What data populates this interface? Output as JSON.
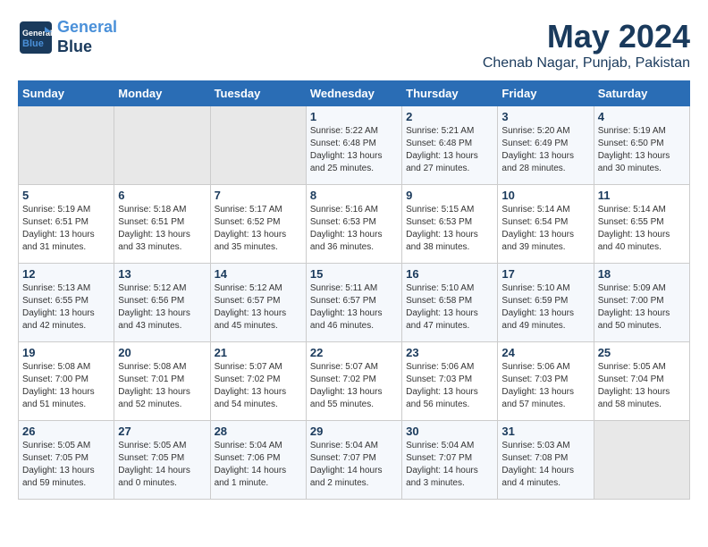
{
  "header": {
    "logo_line1": "General",
    "logo_line2": "Blue",
    "month": "May 2024",
    "location": "Chenab Nagar, Punjab, Pakistan"
  },
  "weekdays": [
    "Sunday",
    "Monday",
    "Tuesday",
    "Wednesday",
    "Thursday",
    "Friday",
    "Saturday"
  ],
  "weeks": [
    [
      {
        "day": "",
        "info": ""
      },
      {
        "day": "",
        "info": ""
      },
      {
        "day": "",
        "info": ""
      },
      {
        "day": "1",
        "info": "Sunrise: 5:22 AM\nSunset: 6:48 PM\nDaylight: 13 hours\nand 25 minutes."
      },
      {
        "day": "2",
        "info": "Sunrise: 5:21 AM\nSunset: 6:48 PM\nDaylight: 13 hours\nand 27 minutes."
      },
      {
        "day": "3",
        "info": "Sunrise: 5:20 AM\nSunset: 6:49 PM\nDaylight: 13 hours\nand 28 minutes."
      },
      {
        "day": "4",
        "info": "Sunrise: 5:19 AM\nSunset: 6:50 PM\nDaylight: 13 hours\nand 30 minutes."
      }
    ],
    [
      {
        "day": "5",
        "info": "Sunrise: 5:19 AM\nSunset: 6:51 PM\nDaylight: 13 hours\nand 31 minutes."
      },
      {
        "day": "6",
        "info": "Sunrise: 5:18 AM\nSunset: 6:51 PM\nDaylight: 13 hours\nand 33 minutes."
      },
      {
        "day": "7",
        "info": "Sunrise: 5:17 AM\nSunset: 6:52 PM\nDaylight: 13 hours\nand 35 minutes."
      },
      {
        "day": "8",
        "info": "Sunrise: 5:16 AM\nSunset: 6:53 PM\nDaylight: 13 hours\nand 36 minutes."
      },
      {
        "day": "9",
        "info": "Sunrise: 5:15 AM\nSunset: 6:53 PM\nDaylight: 13 hours\nand 38 minutes."
      },
      {
        "day": "10",
        "info": "Sunrise: 5:14 AM\nSunset: 6:54 PM\nDaylight: 13 hours\nand 39 minutes."
      },
      {
        "day": "11",
        "info": "Sunrise: 5:14 AM\nSunset: 6:55 PM\nDaylight: 13 hours\nand 40 minutes."
      }
    ],
    [
      {
        "day": "12",
        "info": "Sunrise: 5:13 AM\nSunset: 6:55 PM\nDaylight: 13 hours\nand 42 minutes."
      },
      {
        "day": "13",
        "info": "Sunrise: 5:12 AM\nSunset: 6:56 PM\nDaylight: 13 hours\nand 43 minutes."
      },
      {
        "day": "14",
        "info": "Sunrise: 5:12 AM\nSunset: 6:57 PM\nDaylight: 13 hours\nand 45 minutes."
      },
      {
        "day": "15",
        "info": "Sunrise: 5:11 AM\nSunset: 6:57 PM\nDaylight: 13 hours\nand 46 minutes."
      },
      {
        "day": "16",
        "info": "Sunrise: 5:10 AM\nSunset: 6:58 PM\nDaylight: 13 hours\nand 47 minutes."
      },
      {
        "day": "17",
        "info": "Sunrise: 5:10 AM\nSunset: 6:59 PM\nDaylight: 13 hours\nand 49 minutes."
      },
      {
        "day": "18",
        "info": "Sunrise: 5:09 AM\nSunset: 7:00 PM\nDaylight: 13 hours\nand 50 minutes."
      }
    ],
    [
      {
        "day": "19",
        "info": "Sunrise: 5:08 AM\nSunset: 7:00 PM\nDaylight: 13 hours\nand 51 minutes."
      },
      {
        "day": "20",
        "info": "Sunrise: 5:08 AM\nSunset: 7:01 PM\nDaylight: 13 hours\nand 52 minutes."
      },
      {
        "day": "21",
        "info": "Sunrise: 5:07 AM\nSunset: 7:02 PM\nDaylight: 13 hours\nand 54 minutes."
      },
      {
        "day": "22",
        "info": "Sunrise: 5:07 AM\nSunset: 7:02 PM\nDaylight: 13 hours\nand 55 minutes."
      },
      {
        "day": "23",
        "info": "Sunrise: 5:06 AM\nSunset: 7:03 PM\nDaylight: 13 hours\nand 56 minutes."
      },
      {
        "day": "24",
        "info": "Sunrise: 5:06 AM\nSunset: 7:03 PM\nDaylight: 13 hours\nand 57 minutes."
      },
      {
        "day": "25",
        "info": "Sunrise: 5:05 AM\nSunset: 7:04 PM\nDaylight: 13 hours\nand 58 minutes."
      }
    ],
    [
      {
        "day": "26",
        "info": "Sunrise: 5:05 AM\nSunset: 7:05 PM\nDaylight: 13 hours\nand 59 minutes."
      },
      {
        "day": "27",
        "info": "Sunrise: 5:05 AM\nSunset: 7:05 PM\nDaylight: 14 hours\nand 0 minutes."
      },
      {
        "day": "28",
        "info": "Sunrise: 5:04 AM\nSunset: 7:06 PM\nDaylight: 14 hours\nand 1 minute."
      },
      {
        "day": "29",
        "info": "Sunrise: 5:04 AM\nSunset: 7:07 PM\nDaylight: 14 hours\nand 2 minutes."
      },
      {
        "day": "30",
        "info": "Sunrise: 5:04 AM\nSunset: 7:07 PM\nDaylight: 14 hours\nand 3 minutes."
      },
      {
        "day": "31",
        "info": "Sunrise: 5:03 AM\nSunset: 7:08 PM\nDaylight: 14 hours\nand 4 minutes."
      },
      {
        "day": "",
        "info": ""
      }
    ]
  ]
}
